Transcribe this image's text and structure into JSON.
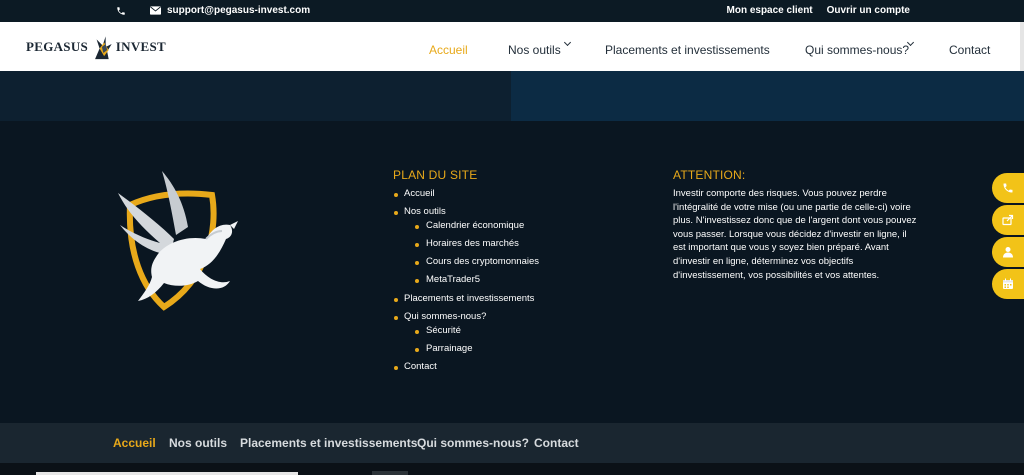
{
  "topbar": {
    "phone_icon": "phone-icon",
    "mail_icon": "mail-icon",
    "email": "support@pegasus-invest.com",
    "links": [
      "Mon espace client",
      "Ouvrir un compte"
    ]
  },
  "logo": {
    "left": "PEGASUS",
    "right": "INVEST"
  },
  "nav": {
    "items": [
      {
        "label": "Accueil",
        "active": true
      },
      {
        "label": "Nos outils",
        "has_dropdown": true
      },
      {
        "label": "Placements et investissements"
      },
      {
        "label": "Qui sommes-nous?",
        "has_dropdown": true
      },
      {
        "label": "Contact"
      }
    ]
  },
  "sitemap": {
    "title": "PLAN DU SITE",
    "items": [
      {
        "label": "Accueil"
      },
      {
        "label": "Nos outils"
      },
      {
        "label": "Calendrier économique"
      },
      {
        "label": "Horaires des marchés"
      },
      {
        "label": "Cours des cryptomonnaies"
      },
      {
        "label": "MetaTrader5"
      },
      {
        "label": "Placements et investissements"
      },
      {
        "label": "Qui sommes-nous?"
      },
      {
        "label": "Sécurité"
      },
      {
        "label": "Parrainage"
      },
      {
        "label": "Contact"
      }
    ]
  },
  "attention": {
    "title": "ATTENTION:",
    "text": "Investir comporte des risques. Vous pouvez perdre l'intégralité de votre mise (ou une partie de celle-ci) voire plus. N'investissez donc que de l'argent dont vous pouvez vous passer. Lorsque vous décidez d'investir en ligne, il est important que vous y soyez bien préparé. Avant d'investir en ligne, déterminez vos objectifs d'investissement, vos possibilités et vos attentes."
  },
  "side_buttons": [
    "phone-icon",
    "share-icon",
    "user-icon",
    "calendar-icon"
  ],
  "bottom_nav": {
    "items": [
      "Accueil",
      "Nos outils",
      "Placements et investissements",
      "Qui sommes-nous?",
      "Contact"
    ]
  },
  "colors": {
    "accent": "#e8a91a",
    "dark_bg": "#0a1621",
    "side_button": "#f2c318"
  }
}
